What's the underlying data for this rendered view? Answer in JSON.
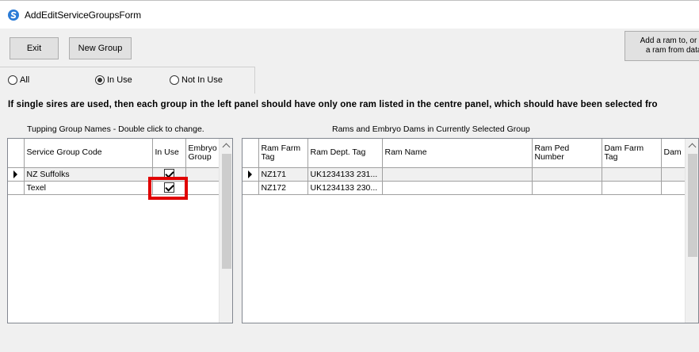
{
  "window": {
    "title": "AddEditServiceGroupsForm",
    "icon": "app-logo-icon"
  },
  "toolbar": {
    "exit_label": "Exit",
    "new_group_label": "New Group",
    "add_ram_line1": "Add a ram to, or re",
    "add_ram_line2": "a ram from datab"
  },
  "filter": {
    "all_label": "All",
    "in_use_label": "In Use",
    "not_in_use_label": "Not In Use",
    "selected": "In Use"
  },
  "info_text": "If single sires are used, then each group in the left panel should have only one ram listed in the centre panel, which should have been selected fro",
  "left_panel": {
    "caption": "Tupping Group Names - Double click to change.",
    "columns": [
      "Service Group Code",
      "In Use",
      "Embryo Group"
    ],
    "rows": [
      {
        "code": "NZ Suffolks",
        "in_use": true,
        "embryo": "",
        "selected": true
      },
      {
        "code": "Texel",
        "in_use": true,
        "embryo": "",
        "selected": false
      }
    ]
  },
  "right_panel": {
    "caption": "Rams and Embryo Dams in Currently Selected Group",
    "columns": [
      "Ram Farm Tag",
      "Ram Dept. Tag",
      "Ram Name",
      "Ram Ped Number",
      "Dam Farm Tag",
      "Dam"
    ],
    "rows": [
      {
        "farm_tag": "NZ171",
        "dept_tag": "UK1234133 231...",
        "name": "",
        "ped": "",
        "dam_farm": "",
        "dam": "",
        "selected": true
      },
      {
        "farm_tag": "NZ172",
        "dept_tag": "UK1234133 230...",
        "name": "",
        "ped": "",
        "dam_farm": "",
        "dam": "",
        "selected": false
      }
    ]
  },
  "colors": {
    "highlight": "#e00000",
    "form_bg": "#f0f0f0"
  }
}
